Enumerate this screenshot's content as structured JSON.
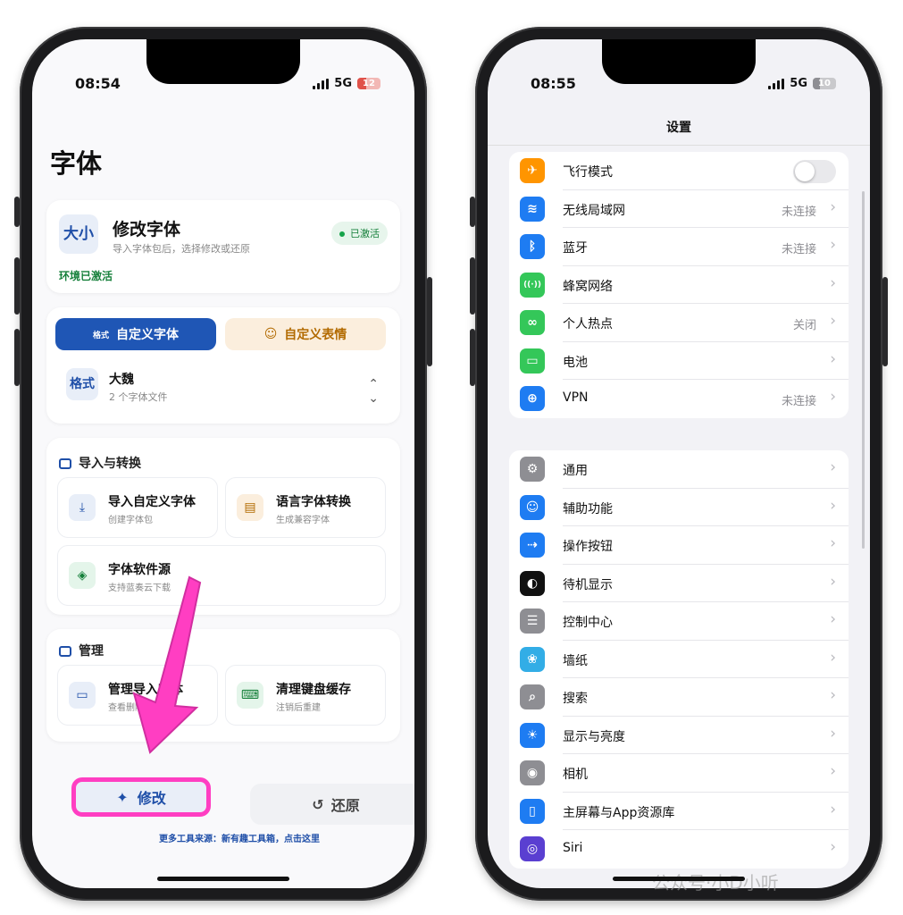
{
  "left_phone": {
    "status": {
      "time": "08:54",
      "network": "5G",
      "battery": "12"
    },
    "page_title": "字体",
    "app": {
      "icon_text": "大小",
      "name": "修改字体",
      "subtitle": "导入字体包后，选择修改或还原",
      "badge": "已激活",
      "env_status": "环境已激活"
    },
    "tabs": {
      "custom_font_prefix": "格式",
      "custom_font": "自定义字体",
      "custom_emoji": "自定义表情"
    },
    "selected_font": {
      "icon_text": "格式",
      "name": "大魏",
      "count": "2 个字体文件"
    },
    "import_section": {
      "title": "导入与转换",
      "tiles": [
        {
          "title": "导入自定义字体",
          "sub": "创建字体包",
          "icon": "download-icon"
        },
        {
          "title": "语言字体转换",
          "sub": "生成兼容字体",
          "icon": "translate-icon"
        },
        {
          "title": "字体软件源",
          "sub": "支持蓝奏云下载",
          "icon": "box-icon"
        }
      ]
    },
    "manage_section": {
      "title": "管理",
      "tiles": [
        {
          "title": "管理导入字体",
          "sub": "查看删除",
          "icon": "folder-icon"
        },
        {
          "title": "清理键盘缓存",
          "sub": "注销后重建",
          "icon": "keyboard-icon"
        }
      ]
    },
    "buttons": {
      "modify": "修改",
      "restore": "还原"
    },
    "footer_link": "更多工具来源：新有趣工具箱，点击这里",
    "annotation_color": "#ff3ec2"
  },
  "right_phone": {
    "status": {
      "time": "08:55",
      "network": "5G",
      "battery": "10"
    },
    "nav_title": "设置",
    "group1": [
      {
        "label": "飞行模式",
        "value": "",
        "color": "#ff9500",
        "icon": "airplane-icon",
        "glyph": "✈",
        "toggle": true
      },
      {
        "label": "无线局域网",
        "value": "未连接",
        "color": "#1e7cf2",
        "icon": "wifi-icon",
        "glyph": "≋"
      },
      {
        "label": "蓝牙",
        "value": "未连接",
        "color": "#1e7cf2",
        "icon": "bluetooth-icon",
        "glyph": "ᛒ"
      },
      {
        "label": "蜂窝网络",
        "value": "",
        "color": "#34c759",
        "icon": "cellular-icon",
        "glyph": "((·))"
      },
      {
        "label": "个人热点",
        "value": "关闭",
        "color": "#34c759",
        "icon": "hotspot-icon",
        "glyph": "∞"
      },
      {
        "label": "电池",
        "value": "",
        "color": "#34c759",
        "icon": "battery-icon",
        "glyph": "▭"
      },
      {
        "label": "VPN",
        "value": "未连接",
        "color": "#1e7cf2",
        "icon": "vpn-icon",
        "glyph": "⊕"
      }
    ],
    "group2": [
      {
        "label": "通用",
        "color": "#8e8e93",
        "icon": "gear-icon",
        "glyph": "⚙"
      },
      {
        "label": "辅助功能",
        "color": "#1e7cf2",
        "icon": "accessibility-icon",
        "glyph": "☺"
      },
      {
        "label": "操作按钮",
        "color": "#1e7cf2",
        "icon": "action-button-icon",
        "glyph": "⇢"
      },
      {
        "label": "待机显示",
        "color": "#111111",
        "icon": "standby-icon",
        "glyph": "◐"
      },
      {
        "label": "控制中心",
        "color": "#8e8e93",
        "icon": "control-center-icon",
        "glyph": "☰"
      },
      {
        "label": "墙纸",
        "color": "#32ade6",
        "icon": "wallpaper-icon",
        "glyph": "❀"
      },
      {
        "label": "搜索",
        "color": "#8e8e93",
        "icon": "search-icon",
        "glyph": "⌕"
      },
      {
        "label": "显示与亮度",
        "color": "#1e7cf2",
        "icon": "brightness-icon",
        "glyph": "☀"
      },
      {
        "label": "相机",
        "color": "#8e8e93",
        "icon": "camera-icon",
        "glyph": "◉"
      },
      {
        "label": "主屏幕与App资源库",
        "color": "#1e7cf2",
        "icon": "home-screen-icon",
        "glyph": "▯"
      },
      {
        "label": "Siri",
        "color": "#5a3fd1",
        "icon": "siri-icon",
        "glyph": "◎"
      }
    ]
  },
  "watermark": "公众号·小D小听"
}
